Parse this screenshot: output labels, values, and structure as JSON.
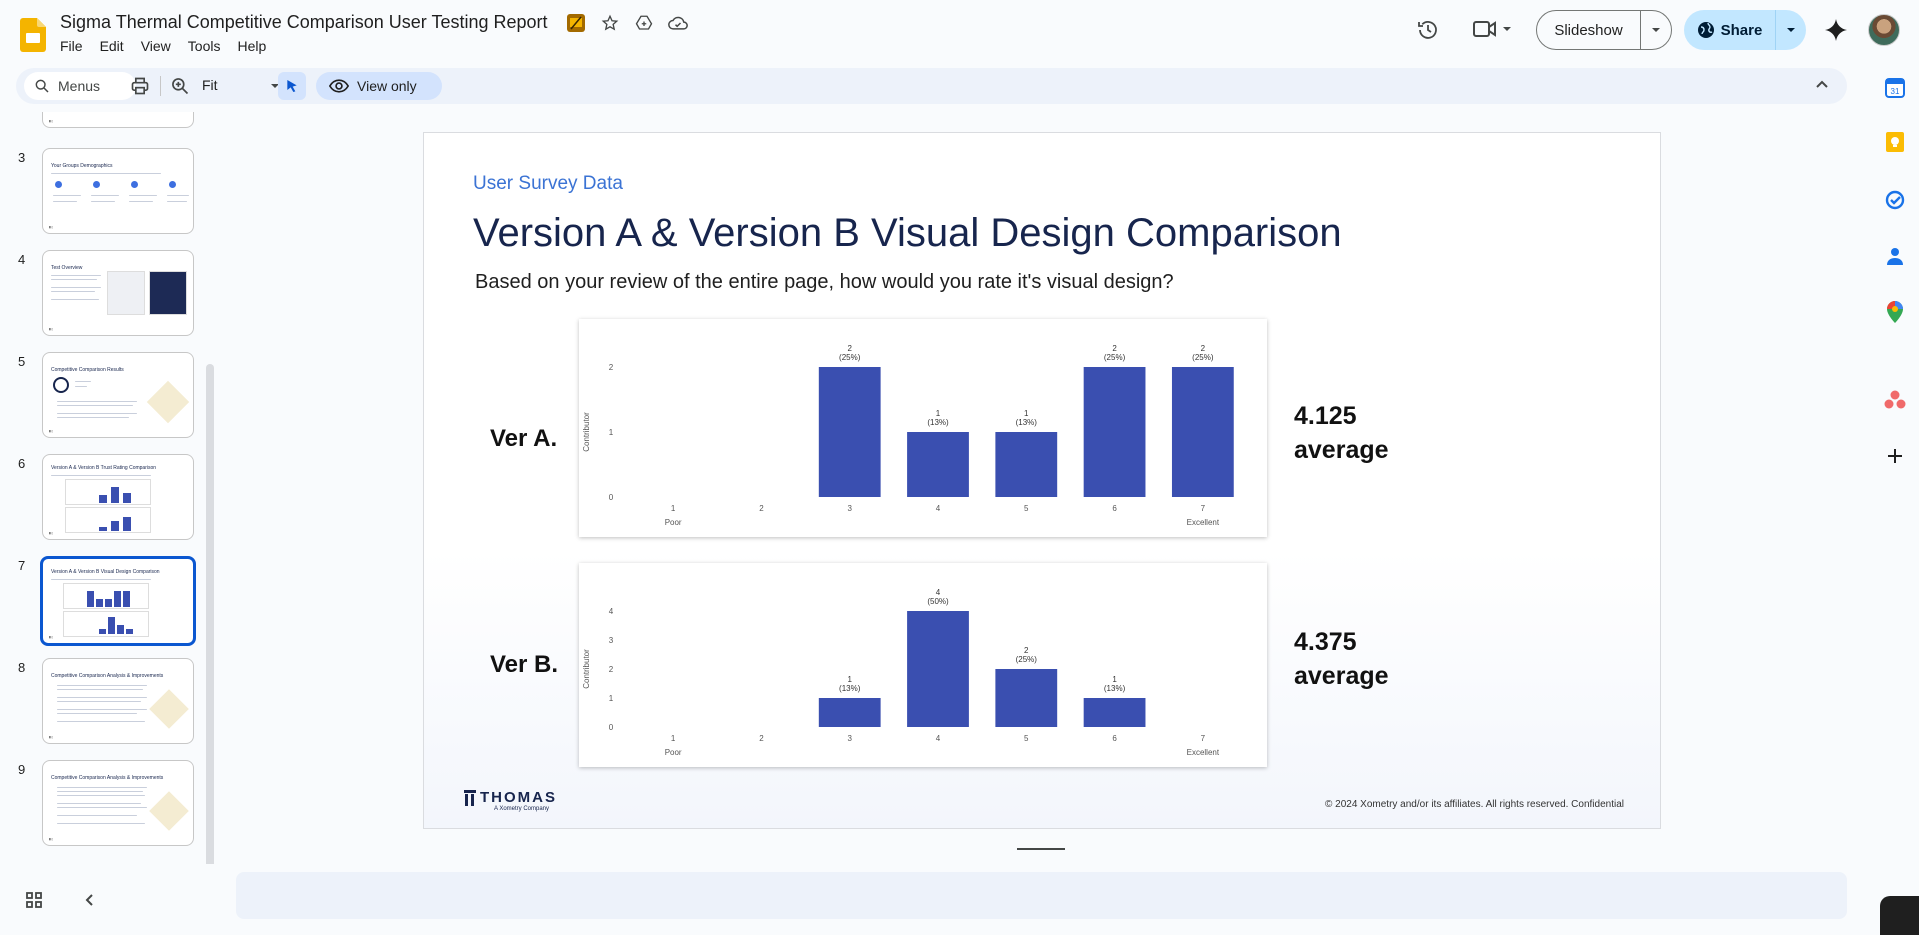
{
  "app": {
    "title": "Sigma Thermal Competitive Comparison User Testing Report",
    "menu": [
      "File",
      "Edit",
      "View",
      "Tools",
      "Help"
    ],
    "slideshow_label": "Slideshow",
    "share_label": "Share"
  },
  "toolbar": {
    "search_placeholder": "Menus",
    "zoom_value": "Fit",
    "view_mode_label": "View only"
  },
  "filmstrip": {
    "slides": [
      {
        "number": "3",
        "title": "Your Groups Demographics"
      },
      {
        "number": "4",
        "title": "Test Overview"
      },
      {
        "number": "5",
        "title": "Competitive Comparison Results"
      },
      {
        "number": "6",
        "title": "Version A & Version B Trust Rating Comparison"
      },
      {
        "number": "7",
        "title": "Version A & Version B Visual Design Comparison"
      },
      {
        "number": "8",
        "title": "Competitive Comparison Analysis & Improvements"
      },
      {
        "number": "9",
        "title": "Competitive Comparison Analysis & Improvements"
      }
    ],
    "active_slide": "7"
  },
  "slide": {
    "eyebrow": "User Survey Data",
    "title": "Version A & Version B Visual Design Comparison",
    "question": "Based on your review of the entire page, how would you rate it's visual design?",
    "ver_a_label": "Ver A.",
    "ver_b_label": "Ver B.",
    "ver_a_avg_value": "4.125",
    "ver_a_avg_label": "average",
    "ver_b_avg_value": "4.375",
    "ver_b_avg_label": "average",
    "logo_text": "THOMAS",
    "logo_subtext": "A Xometry Company",
    "copyright": "© 2024  Xometry and/or its affiliates. All rights reserved. Confidential"
  },
  "colors": {
    "bar": "#3a4fb0",
    "accent": "#0b57d0",
    "title_navy": "#17254d",
    "eyebrow_blue": "#3b73d4"
  },
  "chart_data": [
    {
      "type": "bar",
      "name": "Ver A.",
      "categories": [
        "1",
        "2",
        "3",
        "4",
        "5",
        "6",
        "7"
      ],
      "values": [
        0,
        0,
        2,
        1,
        1,
        2,
        2
      ],
      "data_labels": [
        "",
        "",
        "2\n(25%)",
        "1\n(13%)",
        "1\n(13%)",
        "2\n(25%)",
        "2\n(25%)"
      ],
      "ylabel": "Contributor",
      "xlabel_left": "Poor",
      "xlabel_right": "Excellent",
      "yticks": [
        0,
        1,
        2
      ],
      "ylim": [
        0,
        2
      ]
    },
    {
      "type": "bar",
      "name": "Ver B.",
      "categories": [
        "1",
        "2",
        "3",
        "4",
        "5",
        "6",
        "7"
      ],
      "values": [
        0,
        0,
        1,
        4,
        2,
        1,
        0
      ],
      "data_labels": [
        "",
        "",
        "1\n(13%)",
        "4\n(50%)",
        "2\n(25%)",
        "1\n(13%)",
        ""
      ],
      "ylabel": "Contributor",
      "xlabel_left": "Poor",
      "xlabel_right": "Excellent",
      "yticks": [
        0,
        1,
        2,
        3,
        4
      ],
      "ylim": [
        0,
        4
      ]
    }
  ]
}
